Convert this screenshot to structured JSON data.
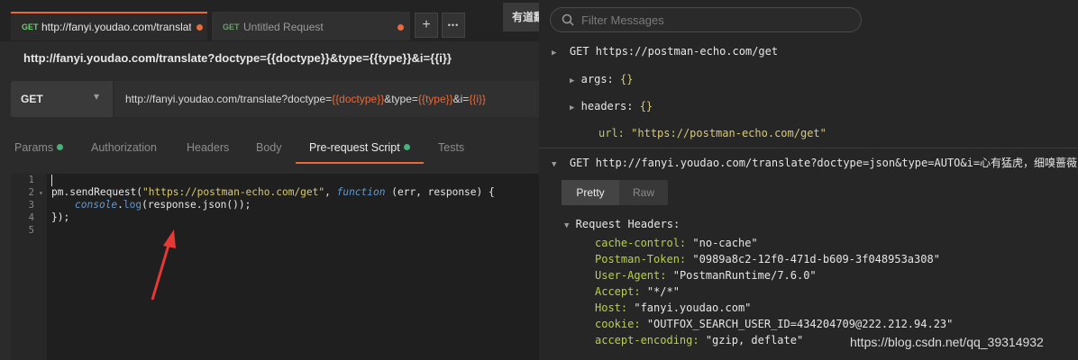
{
  "tabs": [
    {
      "method": "GET",
      "title": "http://fanyi.youdao.com/translat",
      "active": true
    },
    {
      "method": "GET",
      "title": "Untitled Request",
      "active": false
    }
  ],
  "tab_controls": {
    "add": "+",
    "more": "•••"
  },
  "environment": {
    "label": "有道翻"
  },
  "request": {
    "title": "http://fanyi.youdao.com/translate?doctype={{doctype}}&type={{type}}&i={{i}}",
    "method": "GET",
    "url_parts": [
      "http://fanyi.youdao.com/translate?doctype=",
      "{{doctype}}",
      "&type=",
      "{{type}}",
      "&i=",
      "{{i}}"
    ]
  },
  "subtabs": [
    {
      "label": "Params",
      "dot": true
    },
    {
      "label": "Authorization",
      "dot": false
    },
    {
      "label": "Headers",
      "dot": false
    },
    {
      "label": "Body",
      "dot": false
    },
    {
      "label": "Pre-request Script",
      "dot": true,
      "active": true
    },
    {
      "label": "Tests",
      "dot": false
    }
  ],
  "editor": {
    "line_numbers": [
      "1",
      "2",
      "3",
      "4",
      "5"
    ],
    "line2": {
      "a": "pm.sendRequest(",
      "b": "\"https://postman-echo.com/get\"",
      "c": ", ",
      "d": "function",
      "e": " (err, response) {"
    },
    "line3": {
      "a": "console",
      "b": ".",
      "c": "log",
      "d": "(response.json());"
    },
    "line4": "});"
  },
  "console": {
    "filter_placeholder": "Filter Messages",
    "entry1": {
      "method": "GET",
      "url": "https://postman-echo.com/get",
      "args_key": "args:",
      "args_val": "{}",
      "headers_key": "headers:",
      "headers_val": "{}",
      "url_key": "url:",
      "url_val": "\"https://postman-echo.com/get\""
    },
    "entry2": {
      "method": "GET",
      "url": "http://fanyi.youdao.com/translate?doctype=json&type=AUTO&i=心有猛虎，细嗅蔷薇",
      "view_pretty": "Pretty",
      "view_raw": "Raw",
      "section": "Request Headers:",
      "headers": [
        {
          "key": "cache-control:",
          "value": "\"no-cache\""
        },
        {
          "key": "Postman-Token:",
          "value": "\"0989a8c2-12f0-471d-b609-3f048953a308\""
        },
        {
          "key": "User-Agent:",
          "value": "\"PostmanRuntime/7.6.0\""
        },
        {
          "key": "Accept:",
          "value": "\"*/*\""
        },
        {
          "key": "Host:",
          "value": "\"fanyi.youdao.com\""
        },
        {
          "key": "cookie:",
          "value": "\"OUTFOX_SEARCH_USER_ID=434204709@222.212.94.23\""
        },
        {
          "key": "accept-encoding:",
          "value": "\"gzip, deflate\""
        }
      ]
    }
  },
  "watermark": "https://blog.csdn.net/qq_39314932",
  "colors": {
    "accent": "#e8693b",
    "ok": "#4caf7a",
    "string": "#d8c975",
    "keyword": "#5c9ad7",
    "header_key": "#b5d14a"
  }
}
